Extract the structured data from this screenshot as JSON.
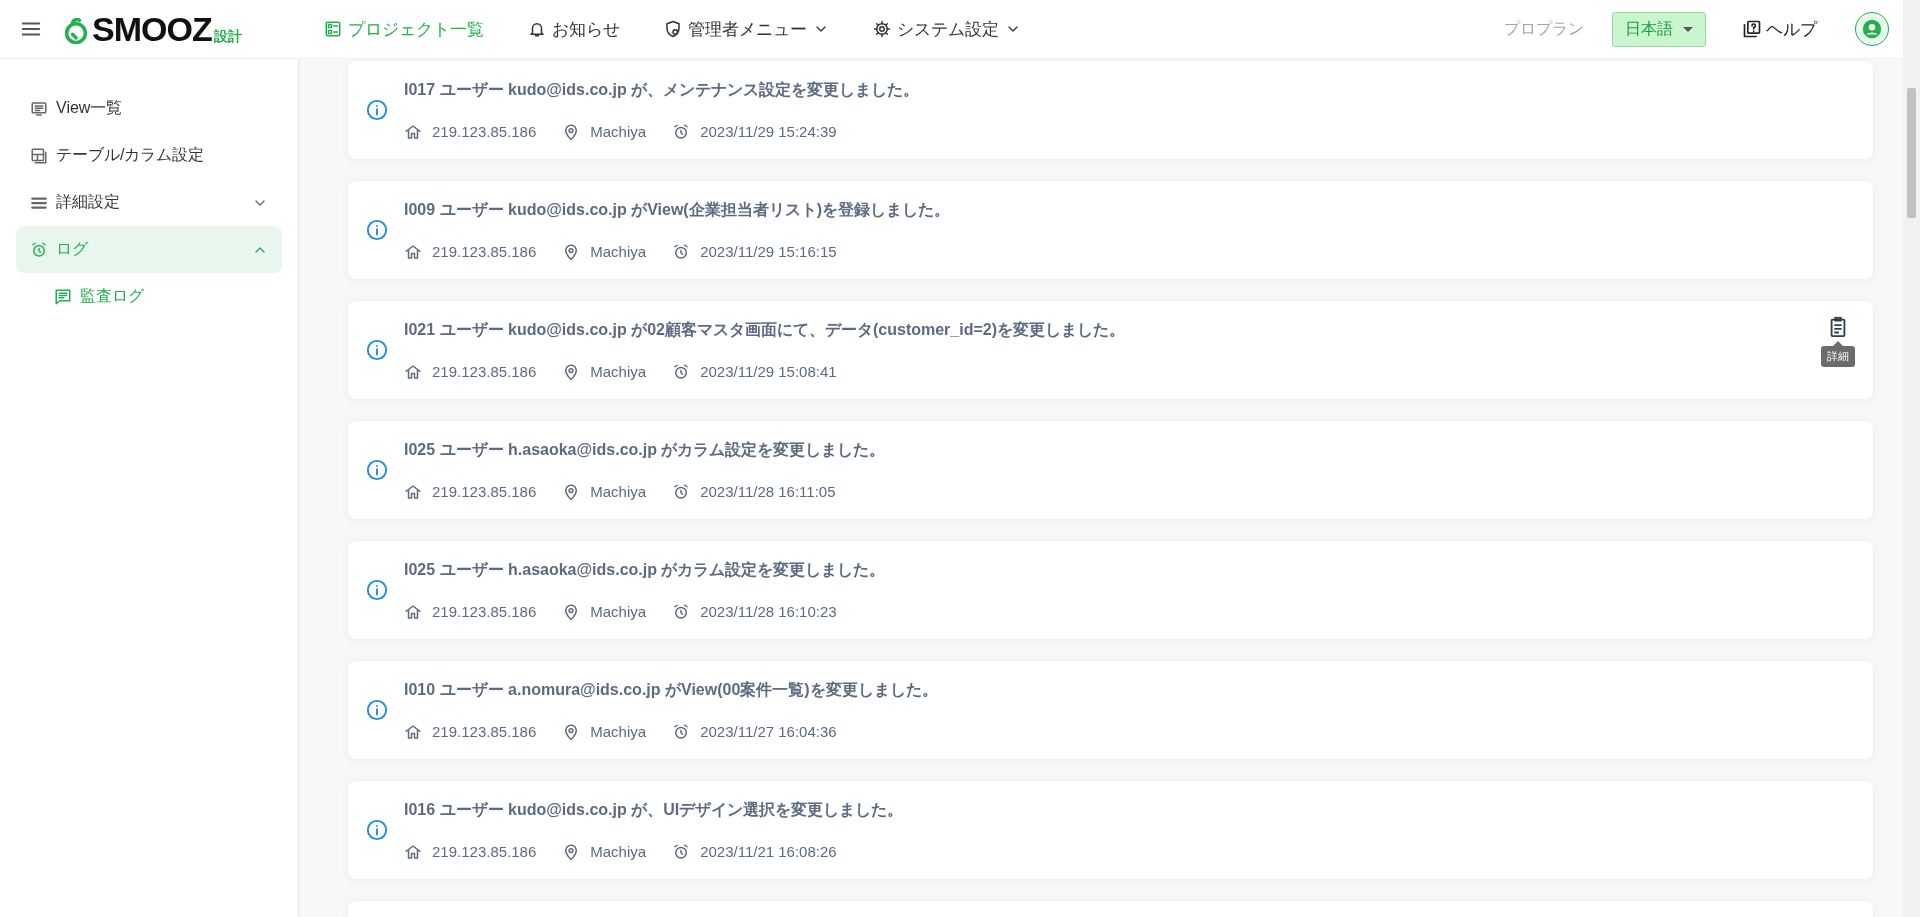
{
  "header": {
    "logo": {
      "word": "SMOOZ",
      "suffix": "設計"
    },
    "nav": [
      {
        "label": "プロジェクト一覧",
        "kind": "link",
        "selected": true
      },
      {
        "label": "お知らせ",
        "kind": "link",
        "selected": false
      },
      {
        "label": "管理者メニュー",
        "kind": "menu",
        "selected": false
      },
      {
        "label": "システム設定",
        "kind": "menu",
        "selected": false
      }
    ],
    "plan": "プロプラン",
    "language": "日本語",
    "help": "ヘルプ"
  },
  "sidebar": {
    "items": [
      {
        "label": "View一覧",
        "kind": "link",
        "selected": false
      },
      {
        "label": "テーブル/カラム設定",
        "kind": "link",
        "selected": false
      },
      {
        "label": "詳細設定",
        "kind": "group",
        "selected": false,
        "expanded": false
      },
      {
        "label": "ログ",
        "kind": "group",
        "selected": true,
        "expanded": true,
        "children": [
          {
            "label": "監査ログ",
            "selected": true
          }
        ]
      }
    ]
  },
  "logs": [
    {
      "message": "I017 ユーザー kudo@ids.co.jp が、メンテナンス設定を変更しました。",
      "ip": "219.123.85.186",
      "location": "Machiya",
      "time": "2023/11/29 15:24:39"
    },
    {
      "message": "I009 ユーザー kudo@ids.co.jp がView(企業担当者リスト)を登録しました。",
      "ip": "219.123.85.186",
      "location": "Machiya",
      "time": "2023/11/29 15:16:15"
    },
    {
      "message": "I021 ユーザー kudo@ids.co.jp が02顧客マスタ画面にて、データ(customer_id=2)を変更しました。",
      "ip": "219.123.85.186",
      "location": "Machiya",
      "time": "2023/11/29 15:08:41",
      "detail_tooltip": "詳細"
    },
    {
      "message": "I025 ユーザー h.asaoka@ids.co.jp がカラム設定を変更しました。",
      "ip": "219.123.85.186",
      "location": "Machiya",
      "time": "2023/11/28 16:11:05"
    },
    {
      "message": "I025 ユーザー h.asaoka@ids.co.jp がカラム設定を変更しました。",
      "ip": "219.123.85.186",
      "location": "Machiya",
      "time": "2023/11/28 16:10:23"
    },
    {
      "message": "I010 ユーザー a.nomura@ids.co.jp がView(00案件一覧)を変更しました。",
      "ip": "219.123.85.186",
      "location": "Machiya",
      "time": "2023/11/27 16:04:36"
    },
    {
      "message": "I016 ユーザー kudo@ids.co.jp が、UIデザイン選択を変更しました。",
      "ip": "219.123.85.186",
      "location": "Machiya",
      "time": "2023/11/21 16:08:26"
    }
  ]
}
